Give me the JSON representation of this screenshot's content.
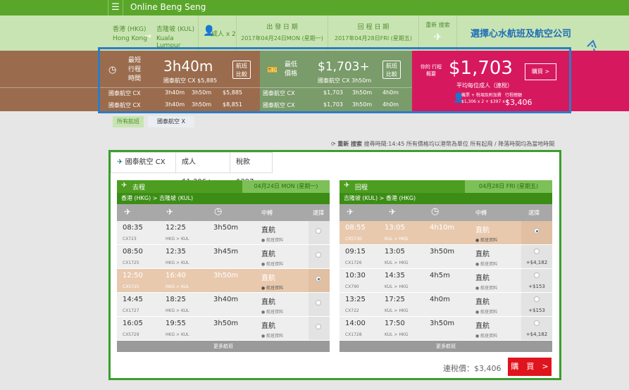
{
  "header": {
    "brand": "Online Beng Seng",
    "menu_icon": "menu-icon"
  },
  "search": {
    "origin_zh": "香港 (HKG)",
    "origin_en": "Hong Kong",
    "dest_zh": "吉隆坡 (KUL)",
    "dest_en": "Kuala Lumpur",
    "passengers": "成人 x 2",
    "depart_label": "出 發 日 期",
    "depart_date": "2017年04月24日MON (星期一)",
    "return_label": "回 程 日 期",
    "return_date": "2017年04月28日FRI (星期五)",
    "research_label": "重新 搜索",
    "annotation": "選擇心水航班及航空公司"
  },
  "summary": {
    "shortest": {
      "label": "最短 行程 時間",
      "time": "3h40m",
      "airline": "國泰航空 CX $5,885",
      "compare": "航班 比較",
      "rows": [
        {
          "airline": "國泰航空 CX",
          "d1": "3h40m",
          "d2": "3h50m",
          "price": "$5,885"
        },
        {
          "airline": "國泰航空 CX",
          "d1": "3h40m",
          "d2": "3h50m",
          "price": "$8,851"
        }
      ]
    },
    "cheapest": {
      "label": "最低 價格",
      "price": "$1,703+",
      "airline": "國泰航空 CX 3h50m",
      "compare": "航班 比較",
      "rows": [
        {
          "airline": "國泰航空 CX",
          "price": "$1,703",
          "d1": "3h50m",
          "d2": "4h0m"
        },
        {
          "airline": "國泰航空 CX",
          "price": "$1,703",
          "d1": "3h50m",
          "d2": "4h0m"
        }
      ]
    },
    "pay": {
      "label": "你的 行程概要",
      "price": "$1,703",
      "per_adult": "平均每位成人（連稅）",
      "buy": "購買 >",
      "breakdown_label": "機票 + 稅項及附加費",
      "breakdown": "$1,306 x 2 + $397 x 2",
      "total_label": "行程總額",
      "total": "$3,406"
    }
  },
  "tabs": {
    "all": "所有航班",
    "cx": "國泰航空 X"
  },
  "research_line": {
    "label": "重新 搜索",
    "text": "搜尋時間:14:45 所有價格均以港幣為單位 所有起飛 / 降落時間均為當地時間"
  },
  "airline_bar": {
    "name": "國泰航空 CX",
    "adult": "成人 $1,306+",
    "tax": "稅款 $397"
  },
  "outbound": {
    "label": "去程",
    "date": "04月24日 MON (星期一)",
    "route": "香港 (HKG) > 吉隆坡 (KUL)",
    "cols": {
      "transfer": "中轉",
      "choose": "選擇"
    },
    "rows": [
      {
        "dep": "08:35",
        "arr": "12:25",
        "dur": "3h50m",
        "stops": "直航",
        "code": "CX723",
        "route": "HKG > KUL",
        "info": "航班資料",
        "price": ""
      },
      {
        "dep": "08:50",
        "arr": "12:35",
        "dur": "3h45m",
        "stops": "直航",
        "code": "CX1725",
        "route": "HKG > KUL",
        "info": "航班資料",
        "price": ""
      },
      {
        "dep": "12:50",
        "arr": "16:40",
        "dur": "3h50m",
        "stops": "直航",
        "code": "CX5725",
        "route": "HKG > KUL",
        "info": "航班資料",
        "price": ""
      },
      {
        "dep": "14:45",
        "arr": "18:25",
        "dur": "3h40m",
        "stops": "直航",
        "code": "CX1727",
        "route": "HKG > KUL",
        "info": "航班資料",
        "price": ""
      },
      {
        "dep": "16:05",
        "arr": "19:55",
        "dur": "3h50m",
        "stops": "直航",
        "code": "CX5729",
        "route": "HKG > KUL",
        "info": "航班資料",
        "price": ""
      }
    ],
    "more": "更多航班"
  },
  "inbound": {
    "label": "回程",
    "date": "04月28日 FRI (星期五)",
    "route": "吉隆坡 (KUL) > 香港 (HKG)",
    "cols": {
      "transfer": "中轉",
      "choose": "選擇"
    },
    "rows": [
      {
        "dep": "08:55",
        "arr": "13:05",
        "dur": "4h10m",
        "stops": "直航",
        "code": "CX5730",
        "route": "KUL > HKG",
        "info": "航班資料",
        "price": ""
      },
      {
        "dep": "09:15",
        "arr": "13:05",
        "dur": "3h50m",
        "stops": "直航",
        "code": "CX1726",
        "route": "KUL > HKG",
        "info": "航班資料",
        "price": "+$4,182"
      },
      {
        "dep": "10:30",
        "arr": "14:35",
        "dur": "4h5m",
        "stops": "直航",
        "code": "CX790",
        "route": "KUL > HKG",
        "info": "航班資料",
        "price": "+$153"
      },
      {
        "dep": "13:25",
        "arr": "17:25",
        "dur": "4h0m",
        "stops": "直航",
        "code": "CX722",
        "route": "KUL > HKG",
        "info": "航班資料",
        "price": "+$153"
      },
      {
        "dep": "14:00",
        "arr": "17:50",
        "dur": "3h50m",
        "stops": "直航",
        "code": "CX1728",
        "route": "KUL > HKG",
        "info": "航班資料",
        "price": "+$4,182"
      }
    ],
    "more": "更多航班"
  },
  "footer": {
    "total_label": "連稅價：$3,406",
    "buy": "購　買　>"
  }
}
